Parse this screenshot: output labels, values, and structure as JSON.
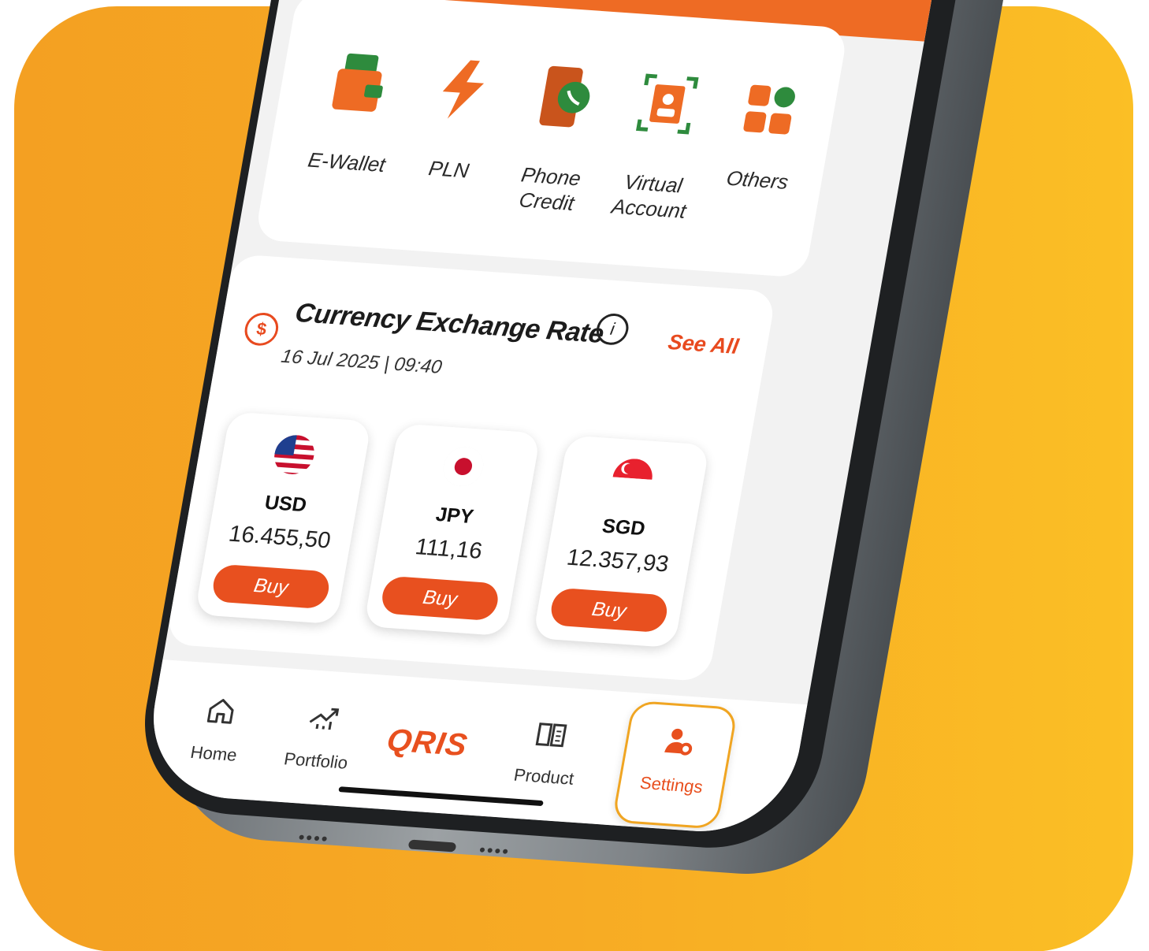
{
  "services": [
    {
      "label": "E-Wallet",
      "icon": "wallet-icon"
    },
    {
      "label": "PLN",
      "icon": "lightning-icon"
    },
    {
      "label": "Phone Credit",
      "icon": "phone-icon"
    },
    {
      "label": "Virtual Account",
      "icon": "account-icon"
    },
    {
      "label": "Others",
      "icon": "grid-icon"
    }
  ],
  "fx": {
    "title": "Currency Exchange Rate",
    "info": "i",
    "see_all": "See All",
    "datetime": "16 Jul 2025 | 09:40",
    "currencies": [
      {
        "code": "USD",
        "value": "16.455,50",
        "buy": "Buy"
      },
      {
        "code": "JPY",
        "value": "111,16",
        "buy": "Buy"
      },
      {
        "code": "SGD",
        "value": "12.357,93",
        "buy": "Buy"
      }
    ]
  },
  "nav": {
    "home": "Home",
    "portfolio": "Portfolio",
    "qris": "QRIS",
    "product": "Product",
    "settings": "Settings"
  },
  "colors": {
    "accent": "#e8501f",
    "highlight": "#f0a522"
  }
}
